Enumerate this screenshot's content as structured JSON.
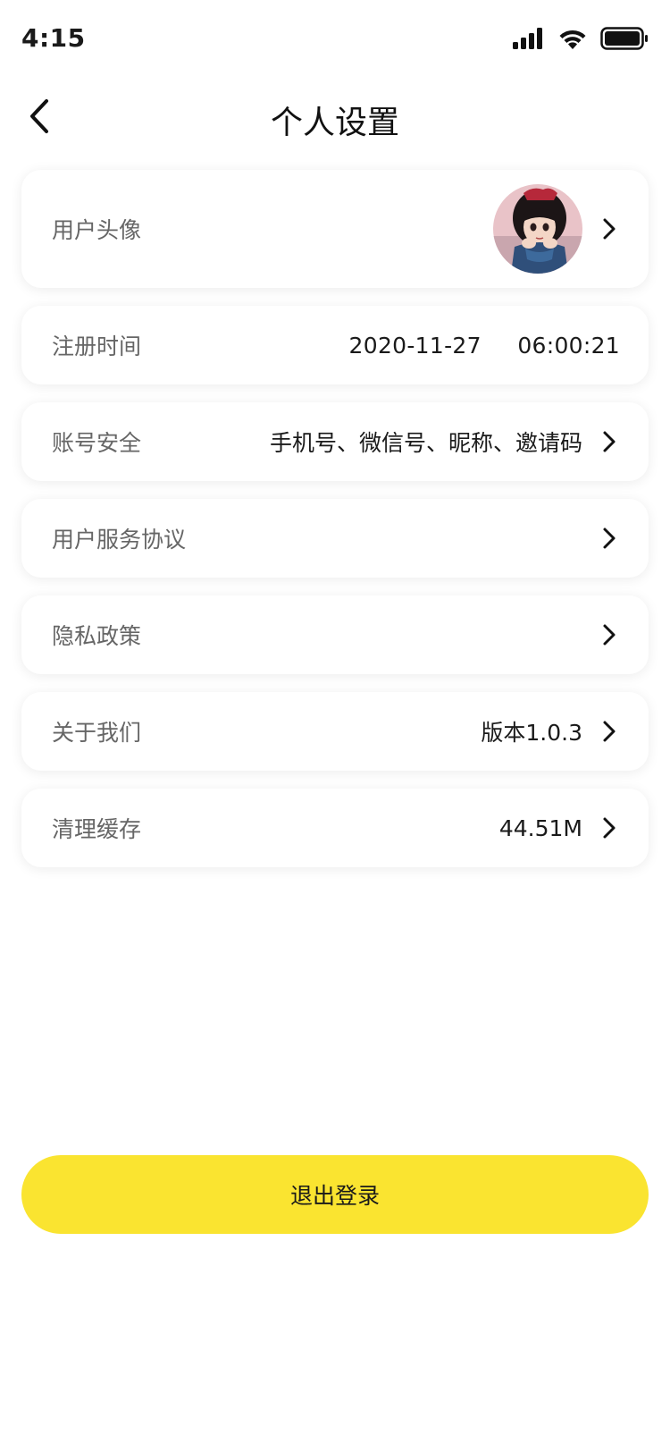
{
  "status_bar": {
    "time": "4:15",
    "icons": [
      "signal-icon",
      "wifi-icon",
      "battery-icon"
    ]
  },
  "nav": {
    "title": "个人设置",
    "back_icon": "chevron-left-icon"
  },
  "settings": {
    "avatar": {
      "label": "用户头像"
    },
    "register_time": {
      "label": "注册时间",
      "value": "2020-11-27  06:00:21"
    },
    "account_security": {
      "label": "账号安全",
      "value": "手机号、微信号、昵称、邀请码"
    },
    "user_agreement": {
      "label": "用户服务协议"
    },
    "privacy_policy": {
      "label": "隐私政策"
    },
    "about_us": {
      "label": "关于我们",
      "value": "版本1.0.3"
    },
    "clear_cache": {
      "label": "清理缓存",
      "value": "44.51M"
    }
  },
  "logout": {
    "label": "退出登录"
  },
  "colors": {
    "accent": "#fae430",
    "label": "#666666",
    "value": "#1a1a1a",
    "background": "#ffffff"
  }
}
